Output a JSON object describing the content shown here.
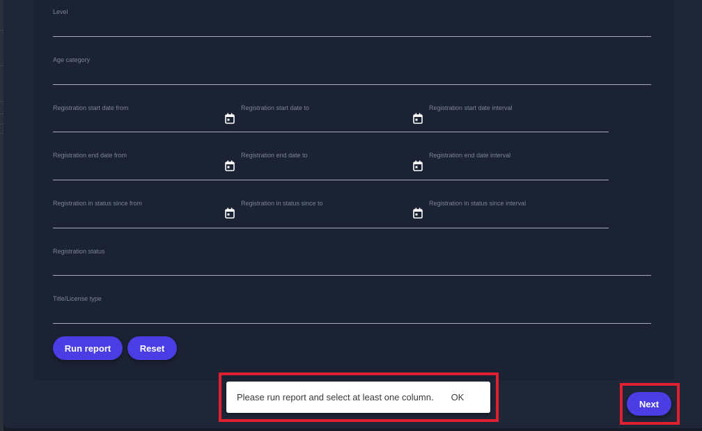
{
  "form": {
    "level_label": "Level",
    "age_category_label": "Age category",
    "reg_start_from_label": "Registration start date from",
    "reg_start_to_label": "Registration start date to",
    "reg_start_interval_label": "Registration start date interval",
    "reg_end_from_label": "Registration end date from",
    "reg_end_to_label": "Registration end date to",
    "reg_end_interval_label": "Registration end date interval",
    "reg_status_since_from_label": "Registration in status since from",
    "reg_status_since_to_label": "Registration in status since to",
    "reg_status_since_interval_label": "Registration in status since interval",
    "reg_status_label": "Registration status",
    "title_license_label": "Title/License type"
  },
  "actions": {
    "run_report_label": "Run report",
    "reset_label": "Reset",
    "next_label": "Next"
  },
  "snackbar": {
    "message": "Please run report and select at least one column.",
    "ok_label": "OK"
  },
  "colors": {
    "accent": "#4a3de4",
    "highlight": "#e02030",
    "background": "#1e2637"
  },
  "icons": {
    "date_picker": "calendar-icon"
  }
}
